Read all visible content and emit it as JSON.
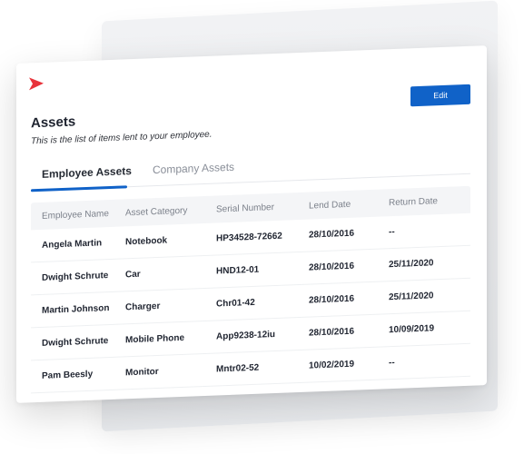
{
  "header": {
    "title": "Assets",
    "subtitle": "This is the list of items lent to your employee.",
    "edit_label": "Edit"
  },
  "tabs": [
    {
      "label": "Employee Assets",
      "active": true
    },
    {
      "label": "Company Assets",
      "active": false
    }
  ],
  "table": {
    "columns": [
      "Employee Name",
      "Asset Category",
      "Serial Number",
      "Lend Date",
      "Return Date"
    ],
    "rows": [
      [
        "Angela Martin",
        "Notebook",
        "HP34528-72662",
        "28/10/2016",
        "--"
      ],
      [
        "Dwight Schrute",
        "Car",
        "HND12-01",
        "28/10/2016",
        "25/11/2020"
      ],
      [
        "Martin Johnson",
        "Charger",
        "Chr01-42",
        "28/10/2016",
        "25/11/2020"
      ],
      [
        "Dwight Schrute",
        "Mobile Phone",
        "App9238-12iu",
        "28/10/2016",
        "10/09/2019"
      ],
      [
        "Pam Beesly",
        "Monitor",
        "Mntr02-52",
        "10/02/2019",
        "--"
      ]
    ]
  },
  "colors": {
    "accent": "#1062c8",
    "logo": "#e8333b"
  },
  "icons": {
    "logo": "logo-icon"
  }
}
